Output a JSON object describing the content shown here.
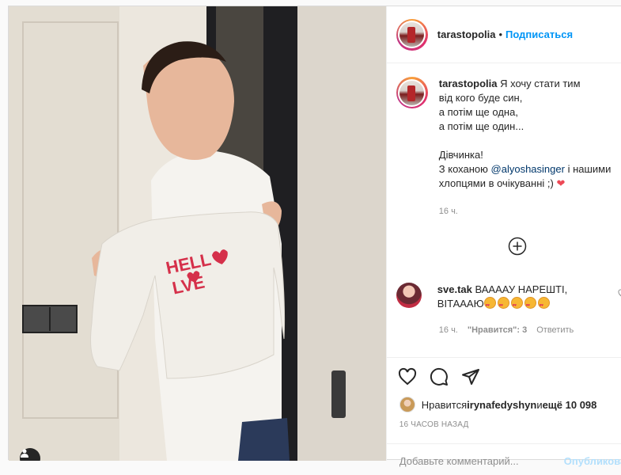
{
  "header": {
    "username": "tarastopolia",
    "separator": "•",
    "follow_label": "Подписаться"
  },
  "caption": {
    "username": "tarastopolia",
    "line1": "Я хочу стати тим",
    "line2": "від кого буде син,",
    "line3": "а потім ще одна,",
    "line4": "а потім ще один...",
    "line5": "Дівчинка!",
    "line6_pre": "З коханою ",
    "mention": "@alyoshasinger",
    "line6_post": " і нашими",
    "line7": "хлопцями в очікуванні ;) ",
    "heart": "❤",
    "time": "16 ч."
  },
  "comment": {
    "username": "sve.tak",
    "text": "ВААААУ НАРЕШТІ, ВІТАААЮ",
    "time": "16 ч.",
    "likes_label": "\"Нравится\": 3",
    "reply_label": "Ответить"
  },
  "actions": {
    "likes_prefix": "Нравится ",
    "likes_user": "irynafedyshyn",
    "likes_mid": " и ",
    "likes_more": "ещё 10 098",
    "time_ago": "16 ЧАСОВ НАЗАД"
  },
  "add_comment": {
    "placeholder": "Добавьте комментарий...",
    "post_label": "Опубликовать"
  },
  "photo": {
    "shirt_text_1": "HELL",
    "shirt_text_2": "LVE"
  },
  "icons": [
    "user-tag-icon",
    "more-icon",
    "heart-icon",
    "comment-icon",
    "share-icon"
  ]
}
